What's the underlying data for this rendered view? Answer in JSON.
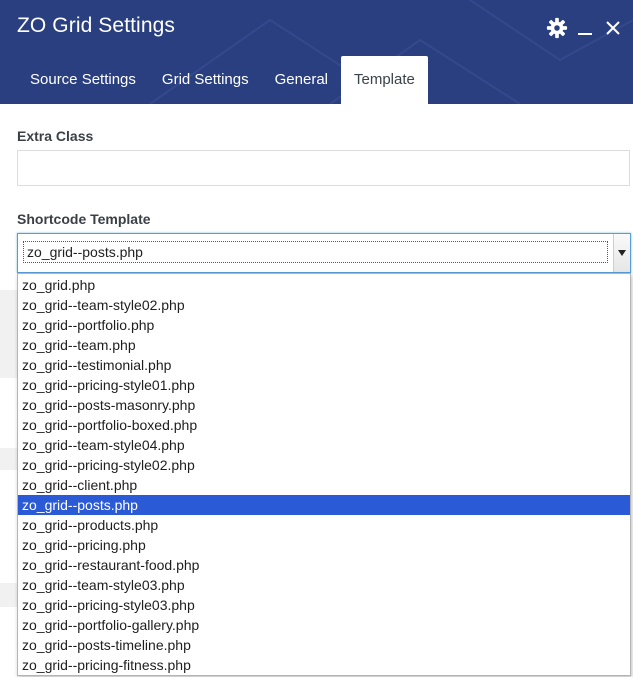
{
  "window": {
    "title": "ZO Grid Settings",
    "controls": [
      "gear-icon",
      "minimize-icon",
      "close-icon"
    ]
  },
  "tabs": [
    {
      "label": "Source Settings",
      "active": false
    },
    {
      "label": "Grid Settings",
      "active": false
    },
    {
      "label": "General",
      "active": false
    },
    {
      "label": "Template",
      "active": true
    }
  ],
  "form": {
    "extra_class": {
      "label": "Extra Class",
      "value": ""
    },
    "shortcode_template": {
      "label": "Shortcode Template",
      "value": "zo_grid--posts.php",
      "options": [
        "zo_grid.php",
        "zo_grid--team-style02.php",
        "zo_grid--portfolio.php",
        "zo_grid--team.php",
        "zo_grid--testimonial.php",
        "zo_grid--pricing-style01.php",
        "zo_grid--posts-masonry.php",
        "zo_grid--portfolio-boxed.php",
        "zo_grid--team-style04.php",
        "zo_grid--pricing-style02.php",
        "zo_grid--client.php",
        "zo_grid--posts.php",
        "zo_grid--products.php",
        "zo_grid--pricing.php",
        "zo_grid--restaurant-food.php",
        "zo_grid--team-style03.php",
        "zo_grid--pricing-style03.php",
        "zo_grid--portfolio-gallery.php",
        "zo_grid--posts-timeline.php",
        "zo_grid--pricing-fitness.php"
      ],
      "selected_index": 11
    }
  },
  "colors": {
    "header_bg": "#2a3f80",
    "selected_option_bg": "#2b5ad6",
    "focus_border": "#5b9dd9"
  }
}
